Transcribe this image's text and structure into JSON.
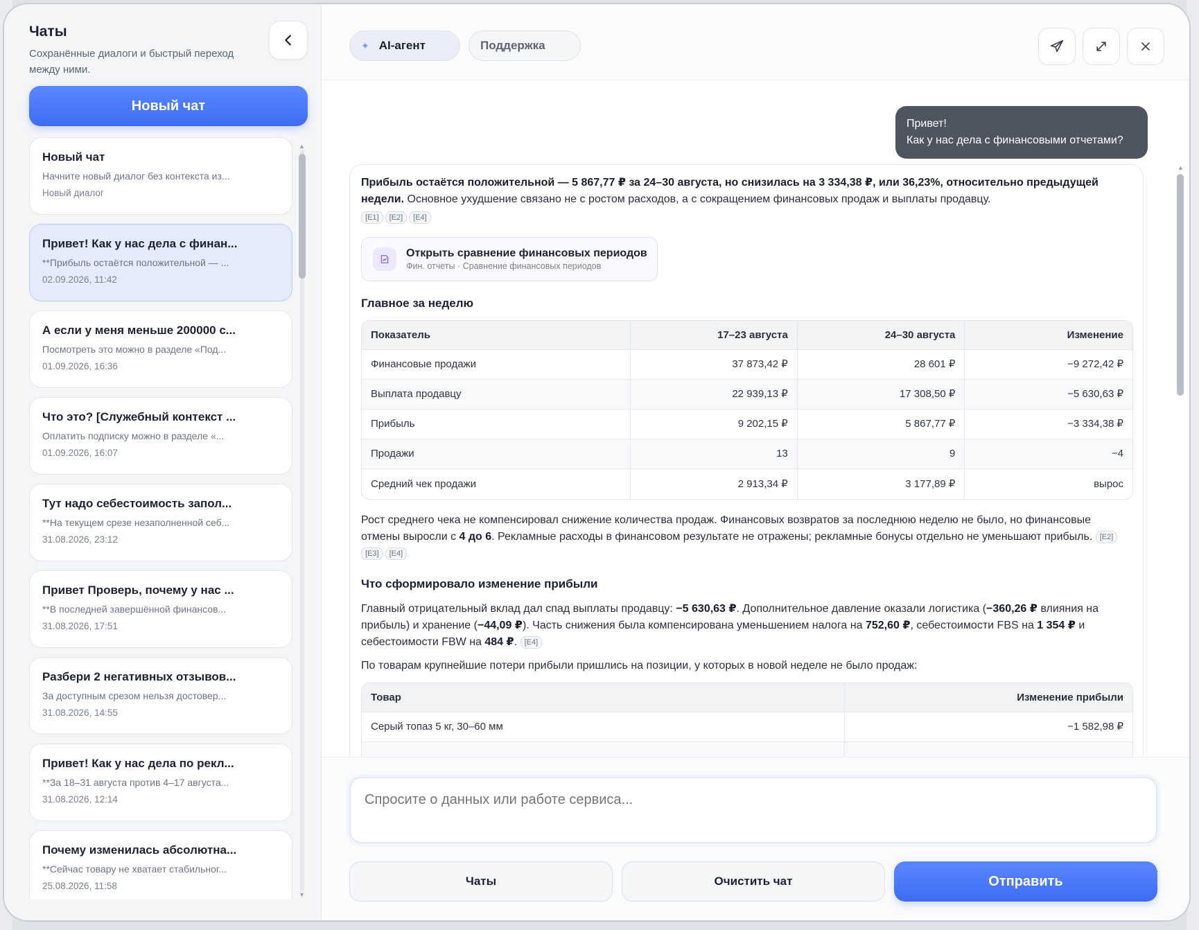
{
  "sidebar": {
    "title": "Чаты",
    "subtitle": "Сохранённые диалоги и быстрый переход между ними.",
    "new_chat_label": "Новый чат",
    "chats": [
      {
        "title": "Новый чат",
        "preview": "Начните новый диалог без контекста из...",
        "date": "Новый диалог",
        "active": false
      },
      {
        "title": "Привет! Как у нас дела с финан...",
        "preview": "**Прибыль остаётся положительной — ...",
        "date": "02.09.2026, 11:42",
        "active": true
      },
      {
        "title": "А если у меня меньше 200000 с...",
        "preview": "Посмотреть это можно в разделе «Под...",
        "date": "01.09.2026, 16:36",
        "active": false
      },
      {
        "title": "Что это? [Служебный контекст ...",
        "preview": "Оплатить подписку можно в разделе «...",
        "date": "01.09.2026, 16:07",
        "active": false
      },
      {
        "title": "Тут надо себестоимость запол...",
        "preview": "**На текущем срезе незаполненной себ...",
        "date": "31.08.2026, 23:12",
        "active": false
      },
      {
        "title": "Привет Проверь, почему у нас ...",
        "preview": "**В последней завершённой финансов...",
        "date": "31.08.2026, 17:51",
        "active": false
      },
      {
        "title": "Разбери 2 негативных отзывов...",
        "preview": "За доступным срезом нельзя достовер...",
        "date": "31.08.2026, 14:55",
        "active": false
      },
      {
        "title": "Привет! Как у нас дела по рекл...",
        "preview": "**За 18–31 августа против 4–17 августа...",
        "date": "31.08.2026, 12:14",
        "active": false
      },
      {
        "title": "Почему изменилась абсолютна...",
        "preview": "**Сейчас товару не хватает стабильног...",
        "date": "25.08.2026, 11:58",
        "active": false
      }
    ]
  },
  "tabs": {
    "agent": "AI-агент",
    "support": "Поддержка"
  },
  "messages": {
    "user": {
      "line1": "Привет!",
      "line2": "Как у нас дела с финансовыми отчетами?"
    },
    "answer": {
      "intro_bold": "Прибыль остаётся положительной — 5 867,77 ₽ за 24–30 августа, но снизилась на 3 334,38 ₽, или 36,23%, относительно предыдущей недели.",
      "intro_rest": " Основное ухудшение связано не с ростом расходов, а с сокращением финансовых продаж и выплаты продавцу.",
      "refs1": [
        "[E1]",
        "[E2]",
        "[E4]"
      ],
      "link_title": "Открыть сравнение финансовых периодов",
      "link_sub": "Фин. отчеты · Сравнение финансовых периодов",
      "section1": "Главное за неделю",
      "table1": {
        "headers": [
          "Показатель",
          "17–23 августа",
          "24–30 августа",
          "Изменение"
        ],
        "rows": [
          [
            "Финансовые продажи",
            "37 873,42 ₽",
            "28 601 ₽",
            "−9 272,42 ₽"
          ],
          [
            "Выплата продавцу",
            "22 939,13 ₽",
            "17 308,50 ₽",
            "−5 630,63 ₽"
          ],
          [
            "Прибыль",
            "9 202,15 ₽",
            "5 867,77 ₽",
            "−3 334,38 ₽"
          ],
          [
            "Продажи",
            "13",
            "9",
            "−4"
          ],
          [
            "Средний чек продажи",
            "2 913,34 ₽",
            "3 177,89 ₽",
            "вырос"
          ]
        ]
      },
      "para1_a": "Рост среднего чека не компенсировал снижение количества продаж. Финансовых возвратов за последнюю неделю не было, но финансовые отмены выросли с ",
      "para1_b": "4 до 6",
      "para1_c": ". Рекламные расходы в финансовом результате не отражены; рекламные бонусы отдельно не уменьшают прибыль.",
      "refs2": [
        "[E2]",
        "[E3]",
        "[E4]"
      ],
      "section2": "Что сформировало изменение прибыли",
      "para2_a": "Главный отрицательный вклад дал спад выплаты продавцу: ",
      "para2_b": "−5 630,63 ₽",
      "para2_c": ". Дополнительное давление оказали логистика (",
      "para2_d": "−360,26 ₽",
      "para2_e": " влияния на прибыль) и хранение (",
      "para2_f": "−44,09 ₽",
      "para2_g": "). Часть снижения была компенсирована уменьшением налога на ",
      "para2_h": "752,60 ₽",
      "para2_i": ", себестоимости FBS на ",
      "para2_j": "1 354 ₽",
      "para2_k": " и себестоимости FBW на ",
      "para2_l": "484 ₽",
      "para2_m": ".",
      "refs3": [
        "[E4]"
      ],
      "para3": "По товарам крупнейшие потери прибыли пришлись на позиции, у которых в новой неделе не было продаж:",
      "table2": {
        "headers": [
          "Товар",
          "Изменение прибыли"
        ],
        "rows": [
          [
            "Серый топаз 5 кг, 30–60 мм",
            "−1 582,98 ₽"
          ],
          [
            "",
            ""
          ]
        ]
      }
    }
  },
  "composer": {
    "placeholder": "Спросите о данных или работе сервиса...",
    "chats_label": "Чаты",
    "clear_label": "Очистить чат",
    "send_label": "Отправить"
  },
  "colors": {
    "accent": "#4a78fa",
    "user_bubble": "#4e5561",
    "active_chat": "#e4ecfc"
  }
}
